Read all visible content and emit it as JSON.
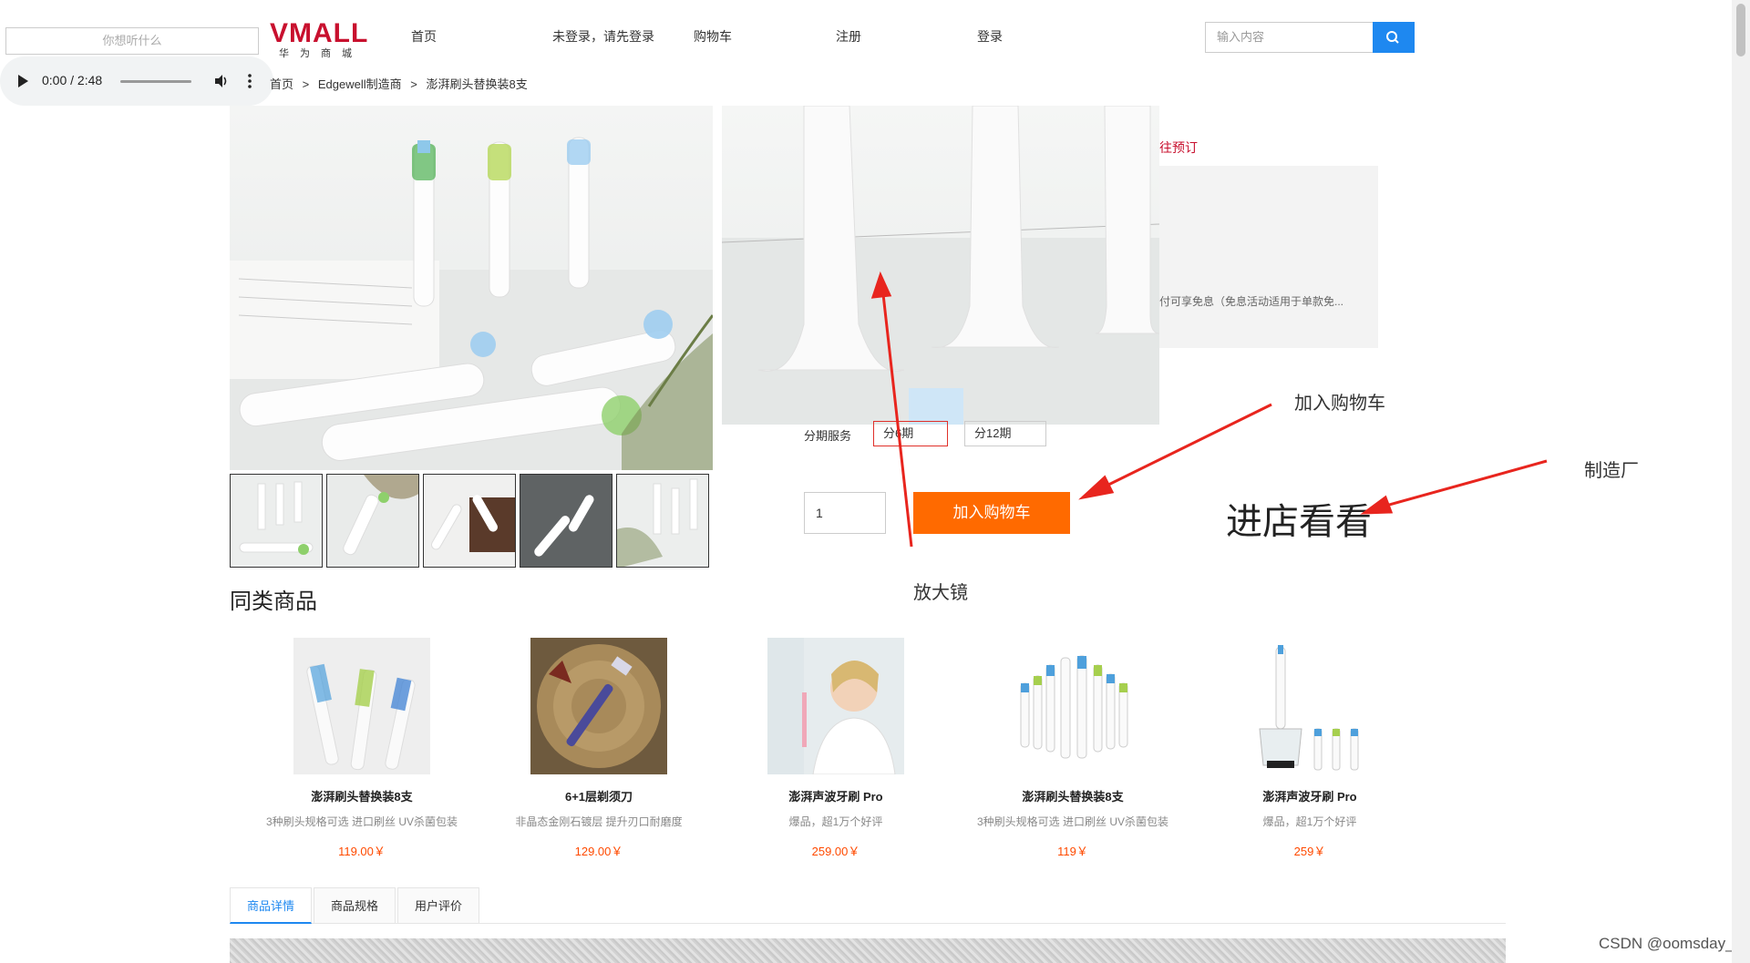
{
  "header": {
    "left_search_placeholder": "你想听什么",
    "logo_main": "VMALL",
    "logo_sub": "华为商城",
    "nav": [
      "首页",
      "未登录，请先登录",
      "购物车",
      "注册",
      "登录"
    ],
    "search_placeholder": "输入内容"
  },
  "audio": {
    "time": "0:00 / 2:48"
  },
  "breadcrumb": [
    "首页",
    ">",
    "Edgewell制造商",
    ">",
    "澎湃刷头替换装8支"
  ],
  "right_panel": {
    "red_link": "往预订",
    "grey_text": "付可享免息（免息活动适用于单款免..."
  },
  "installment": {
    "label": "分期服务",
    "options": [
      "分6期",
      "分12期"
    ]
  },
  "purchase": {
    "quantity": "1",
    "cart_button": "加入购物车"
  },
  "annotations": {
    "add_cart": "加入购物车",
    "factory": "制造厂",
    "magnifier": "放大镜",
    "visit_store": "进店看看"
  },
  "similar": {
    "title": "同类商品",
    "items": [
      {
        "name": "澎湃刷头替换装8支",
        "desc": "3种刷头规格可选 进口刷丝 UV杀菌包装",
        "price": "119.00￥"
      },
      {
        "name": "6+1层剃须刀",
        "desc": "非晶态金刚石镀层 提升刃口耐磨度",
        "price": "129.00￥"
      },
      {
        "name": "澎湃声波牙刷 Pro",
        "desc": "爆品，超1万个好评",
        "price": "259.00￥"
      },
      {
        "name": "澎湃刷头替换装8支",
        "desc": "3种刷头规格可选 进口刷丝 UV杀菌包装",
        "price": "119￥"
      },
      {
        "name": "澎湃声波牙刷 Pro",
        "desc": "爆品，超1万个好评",
        "price": "259￥"
      }
    ]
  },
  "tabs": [
    "商品详情",
    "商品规格",
    "用户评价"
  ],
  "watermark": "CSDN @oomsday_",
  "colors": {
    "accent_blue": "#1e88f0",
    "cart_orange": "#ff6a00",
    "price_orange": "#ff4a00",
    "brand_red": "#c8102e",
    "arrow_red": "#e8251e"
  }
}
